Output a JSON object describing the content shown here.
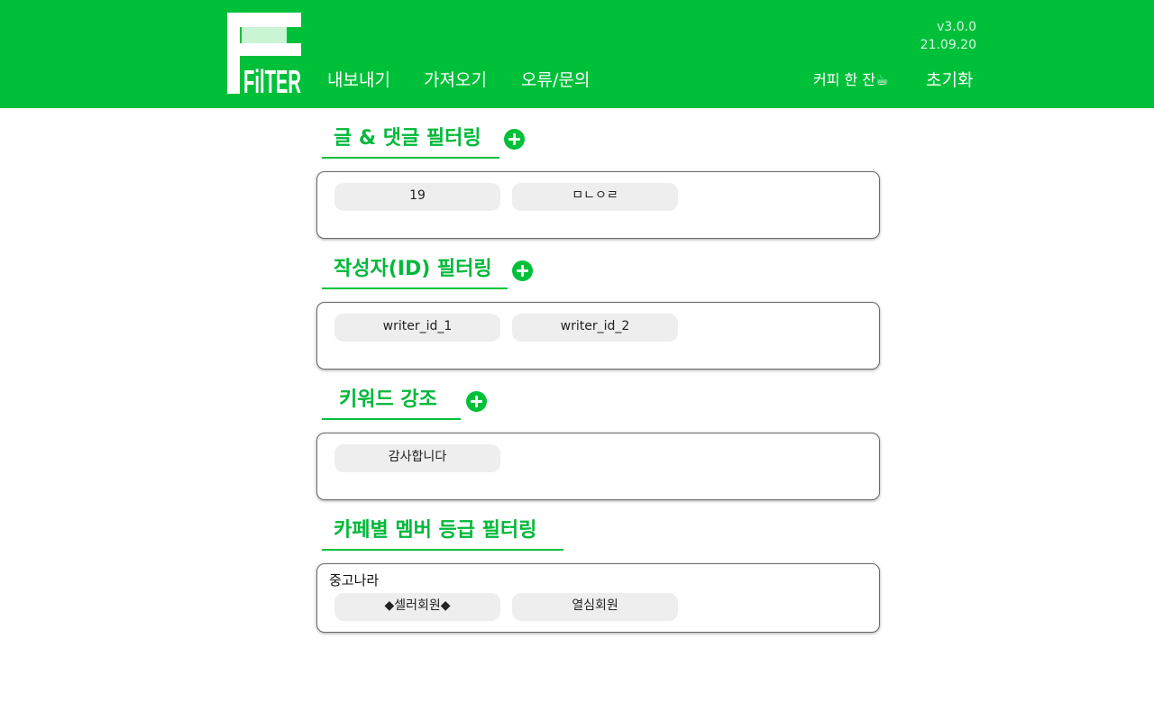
{
  "header": {
    "logo_text": "FilTER",
    "nav": [
      "내보내기",
      "가져오기",
      "오류/문의"
    ],
    "version": "v3.0.0",
    "date": "21.09.20",
    "coffee_label": "커피 한 잔",
    "coffee_icon": "☕",
    "reset_label": "초기화",
    "brand_color": "#00c03a"
  },
  "sections": {
    "post_comment": {
      "title": "글 & 댓글 필터링",
      "items": [
        "19",
        "ㅁㄴㅇㄹ"
      ]
    },
    "writer": {
      "title": "작성자(ID) 필터링",
      "items": [
        "writer_id_1",
        "writer_id_2"
      ]
    },
    "keyword": {
      "title": "키워드 강조",
      "items": [
        "감사합니다"
      ]
    },
    "cafe_grade": {
      "title": "카페별 멤버 등급 필터링",
      "cafe_name": "중고나라",
      "items": [
        "◆셀러회원◆",
        "열심회원"
      ]
    }
  }
}
